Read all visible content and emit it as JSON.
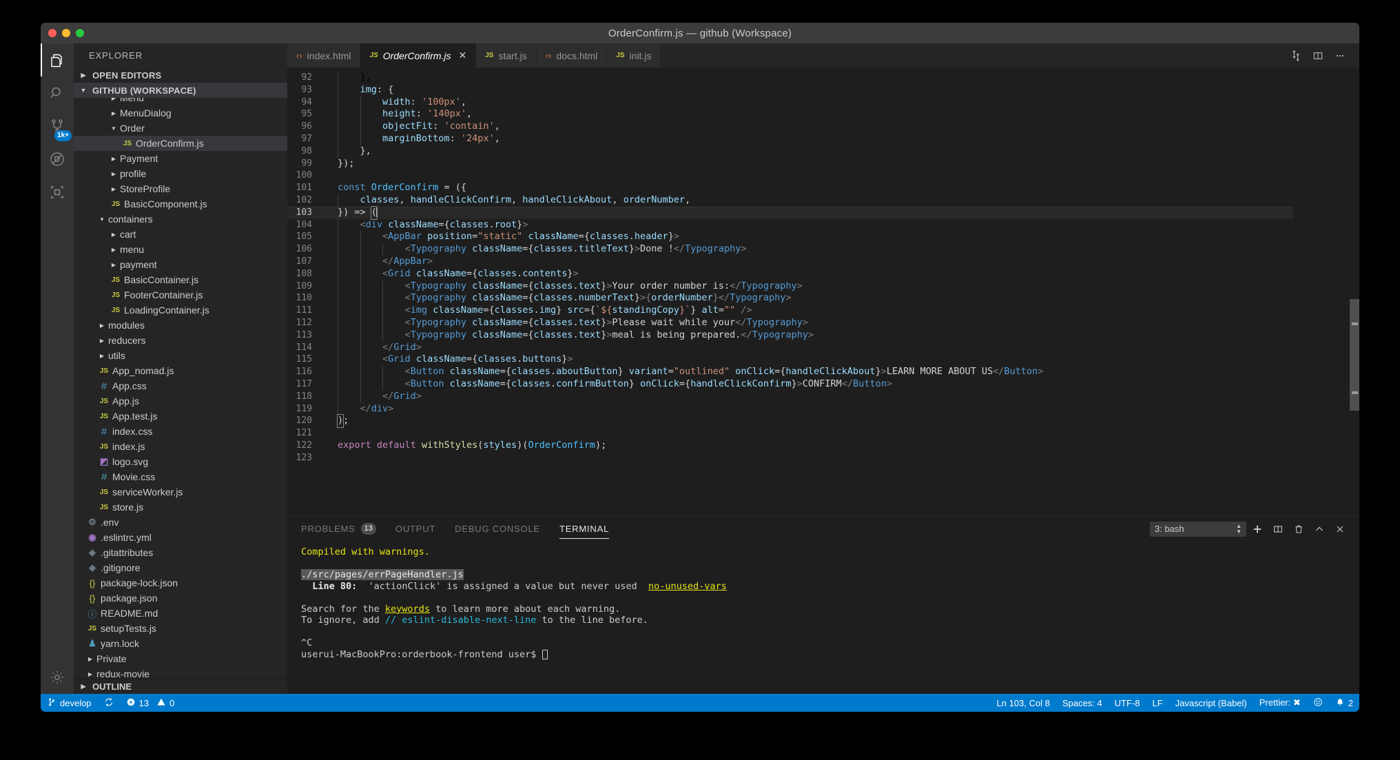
{
  "window": {
    "title": "OrderConfirm.js — github (Workspace)",
    "traffic": [
      "close",
      "minimize",
      "maximize"
    ]
  },
  "activitybar": {
    "items": [
      {
        "name": "explorer",
        "icon": "files-icon",
        "active": true,
        "badge": ""
      },
      {
        "name": "search",
        "icon": "search-icon",
        "active": false,
        "badge": ""
      },
      {
        "name": "source-control",
        "icon": "source-control-icon",
        "active": false,
        "badge": "1k+"
      },
      {
        "name": "run-and-debug",
        "icon": "debug-icon",
        "active": false,
        "badge": ""
      },
      {
        "name": "extensions",
        "icon": "extensions-icon",
        "active": false,
        "badge": ""
      }
    ],
    "bottom": {
      "name": "manage",
      "icon": "gear-icon"
    }
  },
  "sidebar": {
    "title": "EXPLORER",
    "sections": [
      {
        "label": "OPEN EDITORS",
        "expanded": false
      },
      {
        "label": "GITHUB (WORKSPACE)",
        "expanded": true
      }
    ],
    "outline_label": "OUTLINE",
    "tree": [
      {
        "label": "Menu",
        "kind": "folder",
        "depth": 3,
        "expanded": false,
        "clipped": true
      },
      {
        "label": "MenuDialog",
        "kind": "folder",
        "depth": 3,
        "expanded": false
      },
      {
        "label": "Order",
        "kind": "folder",
        "depth": 3,
        "expanded": true
      },
      {
        "label": "OrderConfirm.js",
        "kind": "js",
        "depth": 4,
        "selected": true
      },
      {
        "label": "Payment",
        "kind": "folder",
        "depth": 3,
        "expanded": false
      },
      {
        "label": "profile",
        "kind": "folder",
        "depth": 3,
        "expanded": false
      },
      {
        "label": "StoreProfile",
        "kind": "folder",
        "depth": 3,
        "expanded": false
      },
      {
        "label": "BasicComponent.js",
        "kind": "js",
        "depth": 3
      },
      {
        "label": "containers",
        "kind": "folder",
        "depth": 2,
        "expanded": true
      },
      {
        "label": "cart",
        "kind": "folder",
        "depth": 3,
        "expanded": false
      },
      {
        "label": "menu",
        "kind": "folder",
        "depth": 3,
        "expanded": false
      },
      {
        "label": "payment",
        "kind": "folder",
        "depth": 3,
        "expanded": false
      },
      {
        "label": "BasicContainer.js",
        "kind": "js",
        "depth": 3
      },
      {
        "label": "FooterContainer.js",
        "kind": "js",
        "depth": 3
      },
      {
        "label": "LoadingContainer.js",
        "kind": "js",
        "depth": 3
      },
      {
        "label": "modules",
        "kind": "folder",
        "depth": 2,
        "expanded": false
      },
      {
        "label": "reducers",
        "kind": "folder",
        "depth": 2,
        "expanded": false
      },
      {
        "label": "utils",
        "kind": "folder",
        "depth": 2,
        "expanded": false
      },
      {
        "label": "App_nomad.js",
        "kind": "js",
        "depth": 2
      },
      {
        "label": "App.css",
        "kind": "css",
        "depth": 2
      },
      {
        "label": "App.js",
        "kind": "js",
        "depth": 2
      },
      {
        "label": "App.test.js",
        "kind": "js",
        "depth": 2
      },
      {
        "label": "index.css",
        "kind": "css",
        "depth": 2
      },
      {
        "label": "index.js",
        "kind": "js",
        "depth": 2
      },
      {
        "label": "logo.svg",
        "kind": "svg",
        "depth": 2
      },
      {
        "label": "Movie.css",
        "kind": "css",
        "depth": 2
      },
      {
        "label": "serviceWorker.js",
        "kind": "js",
        "depth": 2
      },
      {
        "label": "store.js",
        "kind": "js",
        "depth": 2
      },
      {
        "label": ".env",
        "kind": "env",
        "depth": 1
      },
      {
        "label": ".eslintrc.yml",
        "kind": "yml",
        "depth": 1
      },
      {
        "label": ".gitattributes",
        "kind": "git",
        "depth": 1
      },
      {
        "label": ".gitignore",
        "kind": "git",
        "depth": 1
      },
      {
        "label": "package-lock.json",
        "kind": "json",
        "depth": 1
      },
      {
        "label": "package.json",
        "kind": "json",
        "depth": 1
      },
      {
        "label": "README.md",
        "kind": "md",
        "depth": 1
      },
      {
        "label": "setupTests.js",
        "kind": "js",
        "depth": 1
      },
      {
        "label": "yarn.lock",
        "kind": "lock",
        "depth": 1
      },
      {
        "label": "Private",
        "kind": "folder",
        "depth": 1,
        "expanded": false
      },
      {
        "label": "redux-movie",
        "kind": "folder",
        "depth": 1,
        "expanded": false
      }
    ]
  },
  "tabs": [
    {
      "label": "index.html",
      "kind": "html",
      "active": false,
      "dirty": false
    },
    {
      "label": "OrderConfirm.js",
      "kind": "js",
      "active": true,
      "dirty": false,
      "close": "✕"
    },
    {
      "label": "start.js",
      "kind": "js",
      "active": false,
      "dirty": false
    },
    {
      "label": "docs.html",
      "kind": "html",
      "active": false,
      "dirty": false
    },
    {
      "label": "init.js",
      "kind": "js",
      "active": false,
      "dirty": false
    }
  ],
  "editor_actions": [
    {
      "name": "split-editor-icon"
    },
    {
      "name": "open-changes-icon"
    },
    {
      "name": "more-actions-icon",
      "label": "⋯"
    }
  ],
  "code": {
    "first_line": 92,
    "current_line": 103,
    "lines": [
      {
        "n": 92,
        "indent": 1,
        "html": "    },"
      },
      {
        "n": 93,
        "indent": 1,
        "html": "    <span class=\"t-prop\">img</span><span class=\"t-plain\">: {</span>"
      },
      {
        "n": 94,
        "indent": 2,
        "html": "        <span class=\"t-prop\">width</span><span class=\"t-plain\">: </span><span class=\"t-str\">'100px'</span><span class=\"t-plain\">,</span>"
      },
      {
        "n": 95,
        "indent": 2,
        "html": "        <span class=\"t-prop\">height</span><span class=\"t-plain\">: </span><span class=\"t-str\">'140px'</span><span class=\"t-plain\">,</span>"
      },
      {
        "n": 96,
        "indent": 2,
        "html": "        <span class=\"t-prop\">objectFit</span><span class=\"t-plain\">: </span><span class=\"t-str\">'contain'</span><span class=\"t-plain\">,</span>"
      },
      {
        "n": 97,
        "indent": 2,
        "html": "        <span class=\"t-prop\">marginBottom</span><span class=\"t-plain\">: </span><span class=\"t-str\">'24px'</span><span class=\"t-plain\">,</span>"
      },
      {
        "n": 98,
        "indent": 1,
        "html": "    <span class=\"t-plain\">},</span>"
      },
      {
        "n": 99,
        "indent": 0,
        "html": "<span class=\"t-plain\">});</span>"
      },
      {
        "n": 100,
        "indent": 0,
        "html": ""
      },
      {
        "n": 101,
        "indent": 0,
        "html": "<span class=\"t-key\">const</span> <span class=\"t-const\">OrderConfirm</span> <span class=\"t-plain\">= ({</span>"
      },
      {
        "n": 102,
        "indent": 1,
        "html": "    <span class=\"t-var\">classes</span><span class=\"t-plain\">, </span><span class=\"t-var\">handleClickConfirm</span><span class=\"t-plain\">, </span><span class=\"t-var\">handleClickAbout</span><span class=\"t-plain\">, </span><span class=\"t-var\">orderNumber</span><span class=\"t-plain\">,</span>"
      },
      {
        "n": 103,
        "indent": 0,
        "cur": true,
        "html": "<span class=\"t-plain\">}) =&gt; </span><span class=\"bracket-hl t-plain\">(</span><span class=\"cursor\"></span>"
      },
      {
        "n": 104,
        "indent": 1,
        "html": "    <span class=\"t-punct\">&lt;</span><span class=\"t-tag\">div</span> <span class=\"t-var\">className</span><span class=\"t-plain\">={</span><span class=\"t-var\">classes</span><span class=\"t-plain\">.</span><span class=\"t-var\">root</span><span class=\"t-plain\">}</span><span class=\"t-punct\">&gt;</span>"
      },
      {
        "n": 105,
        "indent": 2,
        "html": "        <span class=\"t-punct\">&lt;</span><span class=\"t-tag\">AppBar</span> <span class=\"t-var\">position</span><span class=\"t-plain\">=</span><span class=\"t-str\">\"static\"</span> <span class=\"t-var\">className</span><span class=\"t-plain\">={</span><span class=\"t-var\">classes</span><span class=\"t-plain\">.</span><span class=\"t-var\">header</span><span class=\"t-plain\">}</span><span class=\"t-punct\">&gt;</span>"
      },
      {
        "n": 106,
        "indent": 3,
        "html": "            <span class=\"t-punct\">&lt;</span><span class=\"t-tag\">Typography</span> <span class=\"t-var\">className</span><span class=\"t-plain\">={</span><span class=\"t-var\">classes</span><span class=\"t-plain\">.</span><span class=\"t-var\">titleText</span><span class=\"t-plain\">}</span><span class=\"t-punct\">&gt;</span><span class=\"t-plain\">Done !</span><span class=\"t-punct\">&lt;/</span><span class=\"t-tag\">Typography</span><span class=\"t-punct\">&gt;</span>"
      },
      {
        "n": 107,
        "indent": 2,
        "html": "        <span class=\"t-punct\">&lt;/</span><span class=\"t-tag\">AppBar</span><span class=\"t-punct\">&gt;</span>"
      },
      {
        "n": 108,
        "indent": 2,
        "html": "        <span class=\"t-punct\">&lt;</span><span class=\"t-tag\">Grid</span> <span class=\"t-var\">className</span><span class=\"t-plain\">={</span><span class=\"t-var\">classes</span><span class=\"t-plain\">.</span><span class=\"t-var\">contents</span><span class=\"t-plain\">}</span><span class=\"t-punct\">&gt;</span>"
      },
      {
        "n": 109,
        "indent": 3,
        "html": "            <span class=\"t-punct\">&lt;</span><span class=\"t-tag\">Typography</span> <span class=\"t-var\">className</span><span class=\"t-plain\">={</span><span class=\"t-var\">classes</span><span class=\"t-plain\">.</span><span class=\"t-var\">text</span><span class=\"t-plain\">}</span><span class=\"t-punct\">&gt;</span><span class=\"t-plain\">Your order number is:</span><span class=\"t-punct\">&lt;/</span><span class=\"t-tag\">Typography</span><span class=\"t-punct\">&gt;</span>"
      },
      {
        "n": 110,
        "indent": 3,
        "html": "            <span class=\"t-punct\">&lt;</span><span class=\"t-tag\">Typography</span> <span class=\"t-var\">className</span><span class=\"t-plain\">={</span><span class=\"t-var\">classes</span><span class=\"t-plain\">.</span><span class=\"t-var\">numberText</span><span class=\"t-plain\">}</span><span class=\"t-punct\">&gt;{</span><span class=\"t-var\">orderNumber</span><span class=\"t-punct\">}&lt;/</span><span class=\"t-tag\">Typography</span><span class=\"t-punct\">&gt;</span>"
      },
      {
        "n": 111,
        "indent": 3,
        "html": "            <span class=\"t-punct\">&lt;</span><span class=\"t-tag\">img</span> <span class=\"t-var\">className</span><span class=\"t-plain\">={</span><span class=\"t-var\">classes</span><span class=\"t-plain\">.</span><span class=\"t-var\">img</span><span class=\"t-plain\">} </span><span class=\"t-var\">src</span><span class=\"t-plain\">={</span><span class=\"t-str\">`${</span><span class=\"t-var\">standingCopy</span><span class=\"t-str\">}`</span><span class=\"t-plain\">} </span><span class=\"t-var\">alt</span><span class=\"t-plain\">=</span><span class=\"t-str\">\"\"</span> <span class=\"t-punct\">/&gt;</span>"
      },
      {
        "n": 112,
        "indent": 3,
        "html": "            <span class=\"t-punct\">&lt;</span><span class=\"t-tag\">Typography</span> <span class=\"t-var\">className</span><span class=\"t-plain\">={</span><span class=\"t-var\">classes</span><span class=\"t-plain\">.</span><span class=\"t-var\">text</span><span class=\"t-plain\">}</span><span class=\"t-punct\">&gt;</span><span class=\"t-plain\">Please wait while your</span><span class=\"t-punct\">&lt;/</span><span class=\"t-tag\">Typography</span><span class=\"t-punct\">&gt;</span>"
      },
      {
        "n": 113,
        "indent": 3,
        "html": "            <span class=\"t-punct\">&lt;</span><span class=\"t-tag\">Typography</span> <span class=\"t-var\">className</span><span class=\"t-plain\">={</span><span class=\"t-var\">classes</span><span class=\"t-plain\">.</span><span class=\"t-var\">text</span><span class=\"t-plain\">}</span><span class=\"t-punct\">&gt;</span><span class=\"t-plain\">meal is being prepared.</span><span class=\"t-punct\">&lt;/</span><span class=\"t-tag\">Typography</span><span class=\"t-punct\">&gt;</span>"
      },
      {
        "n": 114,
        "indent": 2,
        "html": "        <span class=\"t-punct\">&lt;/</span><span class=\"t-tag\">Grid</span><span class=\"t-punct\">&gt;</span>"
      },
      {
        "n": 115,
        "indent": 2,
        "html": "        <span class=\"t-punct\">&lt;</span><span class=\"t-tag\">Grid</span> <span class=\"t-var\">className</span><span class=\"t-plain\">={</span><span class=\"t-var\">classes</span><span class=\"t-plain\">.</span><span class=\"t-var\">buttons</span><span class=\"t-plain\">}</span><span class=\"t-punct\">&gt;</span>"
      },
      {
        "n": 116,
        "indent": 3,
        "html": "            <span class=\"t-punct\">&lt;</span><span class=\"t-tag\">Button</span> <span class=\"t-var\">className</span><span class=\"t-plain\">={</span><span class=\"t-var\">classes</span><span class=\"t-plain\">.</span><span class=\"t-var\">aboutButton</span><span class=\"t-plain\">} </span><span class=\"t-var\">variant</span><span class=\"t-plain\">=</span><span class=\"t-str\">\"outlined\"</span> <span class=\"t-var\">onClick</span><span class=\"t-plain\">={</span><span class=\"t-var\">handleClickAbout</span><span class=\"t-plain\">}</span><span class=\"t-punct\">&gt;</span><span class=\"t-plain\">LEARN MORE ABOUT US</span><span class=\"t-punct\">&lt;/</span><span class=\"t-tag\">Button</span><span class=\"t-punct\">&gt;</span>"
      },
      {
        "n": 117,
        "indent": 3,
        "html": "            <span class=\"t-punct\">&lt;</span><span class=\"t-tag\">Button</span> <span class=\"t-var\">className</span><span class=\"t-plain\">={</span><span class=\"t-var\">classes</span><span class=\"t-plain\">.</span><span class=\"t-var\">confirmButton</span><span class=\"t-plain\">} </span><span class=\"t-var\">onClick</span><span class=\"t-plain\">={</span><span class=\"t-var\">handleClickConfirm</span><span class=\"t-plain\">}</span><span class=\"t-punct\">&gt;</span><span class=\"t-plain\">CONFIRM</span><span class=\"t-punct\">&lt;/</span><span class=\"t-tag\">Button</span><span class=\"t-punct\">&gt;</span>"
      },
      {
        "n": 118,
        "indent": 2,
        "html": "        <span class=\"t-punct\">&lt;/</span><span class=\"t-tag\">Grid</span><span class=\"t-punct\">&gt;</span>"
      },
      {
        "n": 119,
        "indent": 1,
        "html": "    <span class=\"t-punct\">&lt;/</span><span class=\"t-tag\">div</span><span class=\"t-punct\">&gt;</span>"
      },
      {
        "n": 120,
        "indent": 0,
        "html": "<span class=\"bracket-hl t-plain\">)</span><span class=\"t-plain\">;</span>"
      },
      {
        "n": 121,
        "indent": 0,
        "html": ""
      },
      {
        "n": 122,
        "indent": 0,
        "html": "<span class=\"t-ctl\">export</span> <span class=\"t-ctl\">default</span> <span class=\"t-fn\">withStyles</span><span class=\"t-plain\">(</span><span class=\"t-var\">styles</span><span class=\"t-plain\">)(</span><span class=\"t-const\">OrderConfirm</span><span class=\"t-plain\">);</span>"
      },
      {
        "n": 123,
        "indent": 0,
        "html": ""
      }
    ]
  },
  "panel": {
    "tabs": [
      {
        "label": "PROBLEMS",
        "badge": "13",
        "active": false
      },
      {
        "label": "OUTPUT",
        "badge": "",
        "active": false
      },
      {
        "label": "DEBUG CONSOLE",
        "badge": "",
        "active": false
      },
      {
        "label": "TERMINAL",
        "badge": "",
        "active": true
      }
    ],
    "terminal_select": "3: bash",
    "actions": [
      {
        "name": "new-terminal-icon",
        "glyph": "+"
      },
      {
        "name": "split-terminal-icon",
        "glyph": "split"
      },
      {
        "name": "kill-terminal-icon",
        "glyph": "trash"
      },
      {
        "name": "maximize-panel-icon",
        "glyph": "chevron-up"
      },
      {
        "name": "close-panel-icon",
        "glyph": "close"
      }
    ],
    "terminal_lines": [
      {
        "html": "<span class=\"tl-warn\">Compiled with warnings.</span>"
      },
      {
        "html": ""
      },
      {
        "html": "<span class=\"tl-file\">./src/pages/errPageHandler.js</span>"
      },
      {
        "html": "  <span class=\"tl-bold\">Line 80:</span>  'actionClick' is assigned a value but never used  <span class=\"tl-link\">no-unused-vars</span>"
      },
      {
        "html": ""
      },
      {
        "html": "Search for the <span class=\"tl-link\">keywords</span> to learn more about each warning."
      },
      {
        "html": "To ignore, add <span class=\"tl-cyan\">// eslint-disable-next-line</span> to the line before."
      },
      {
        "html": ""
      },
      {
        "html": "^C"
      },
      {
        "html": "userui-MacBookPro:orderbook-frontend user$ <span class=\"tl-cursor\"></span>"
      }
    ]
  },
  "statusbar": {
    "left": [
      {
        "name": "branch",
        "icon": "source-control-branch-icon",
        "label": "develop"
      },
      {
        "name": "sync",
        "icon": "sync-icon",
        "label": ""
      },
      {
        "name": "errors",
        "icon": "error-icon",
        "label": "13"
      },
      {
        "name": "warnings",
        "icon": "warning-icon",
        "label": "0"
      }
    ],
    "right": [
      {
        "name": "cursor-position",
        "label": "Ln 103, Col 8"
      },
      {
        "name": "indentation",
        "label": "Spaces: 4"
      },
      {
        "name": "encoding",
        "label": "UTF-8"
      },
      {
        "name": "eol",
        "label": "LF"
      },
      {
        "name": "language-mode",
        "label": "Javascript (Babel)"
      },
      {
        "name": "prettier",
        "label": "Prettier: ✖"
      },
      {
        "name": "feedback-smiley",
        "label": ""
      },
      {
        "name": "notifications",
        "label": "2"
      }
    ]
  },
  "colors": {
    "accent": "#007acc",
    "editor_bg": "#1e1e1e",
    "sidebar_bg": "#252526",
    "activitybar_bg": "#333333",
    "titlebar_bg": "#3c3c3c"
  }
}
